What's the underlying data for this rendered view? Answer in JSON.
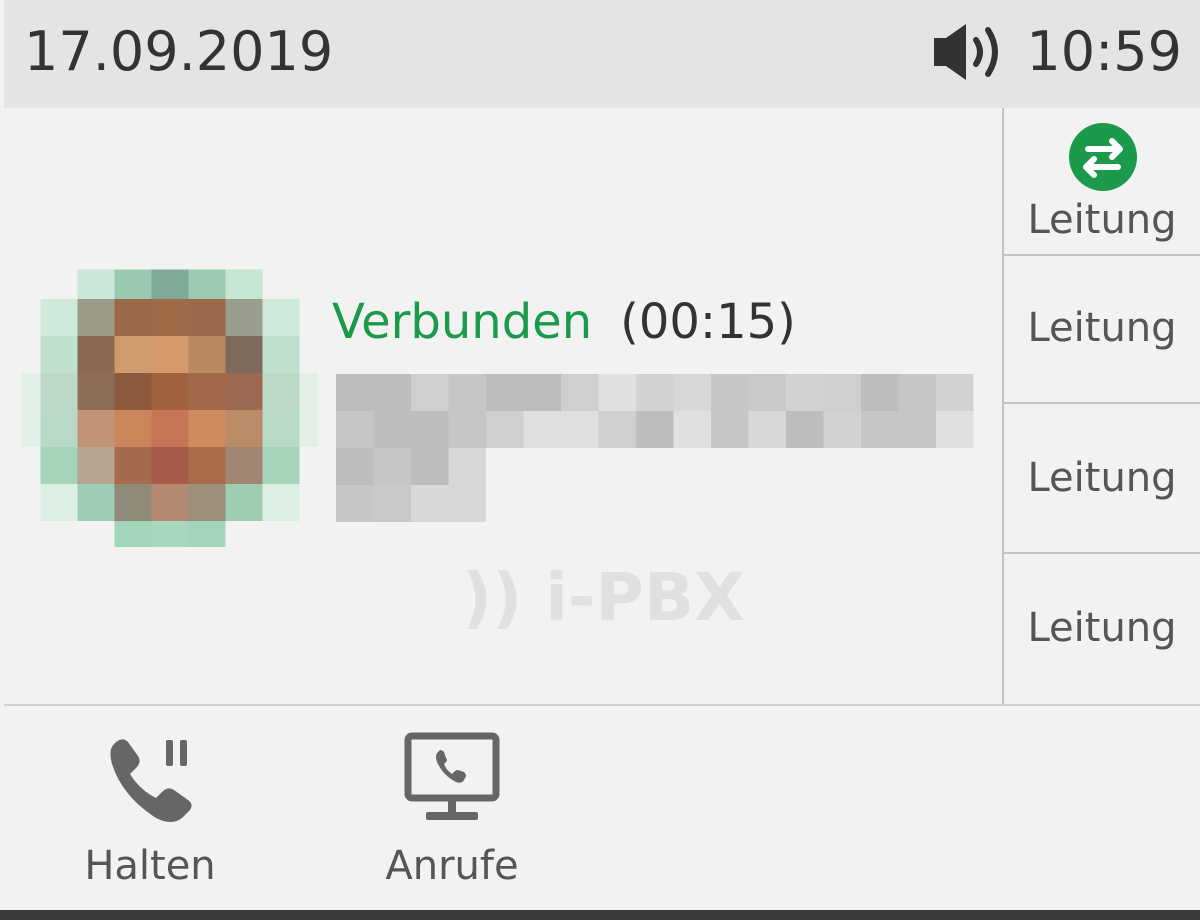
{
  "status_bar": {
    "date": "17.09.2019",
    "time": "10:59",
    "speaker_icon": "speaker-volume-icon"
  },
  "call": {
    "state": "Verbunden",
    "duration": "(00:15)",
    "caller_name": "",
    "state_color": "#1a9a4a"
  },
  "brand": {
    "watermark": ")) i-PBX"
  },
  "line_keys": [
    {
      "label": "Leitung",
      "active": true,
      "icon": "transfer-arrows-icon",
      "icon_color": "#1a9a4a"
    },
    {
      "label": "Leitung",
      "active": false
    },
    {
      "label": "Leitung",
      "active": false
    },
    {
      "label": "Leitung",
      "active": false
    }
  ],
  "softkeys": [
    {
      "label": "Halten",
      "icon": "phone-hold-icon"
    },
    {
      "label": "Anrufe",
      "icon": "monitor-phone-icon"
    }
  ]
}
